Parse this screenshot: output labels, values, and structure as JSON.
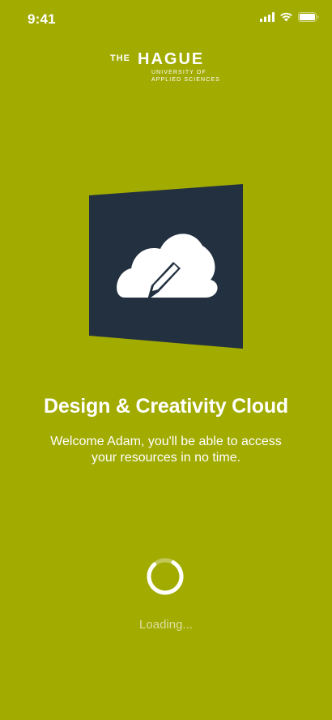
{
  "status_bar": {
    "time": "9:41",
    "icons": [
      "signal-icon",
      "wifi-icon",
      "battery-icon"
    ]
  },
  "logo": {
    "the": "THE",
    "name": "HAGUE",
    "subline_1": "UNIVERSITY OF",
    "subline_2": "APPLIED SCIENCES"
  },
  "app_tile": {
    "icon": "cloud-pencil-icon",
    "tile_color": "#223040",
    "icon_color": "#ffffff"
  },
  "colors": {
    "background": "#a2ab00",
    "text": "#ffffff"
  },
  "main": {
    "title": "Design & Creativity Cloud",
    "subtitle": "Welcome Adam, you'll be able to access your resources in no time.",
    "loading_label": "Loading...",
    "spinner_progress": 0.8
  }
}
